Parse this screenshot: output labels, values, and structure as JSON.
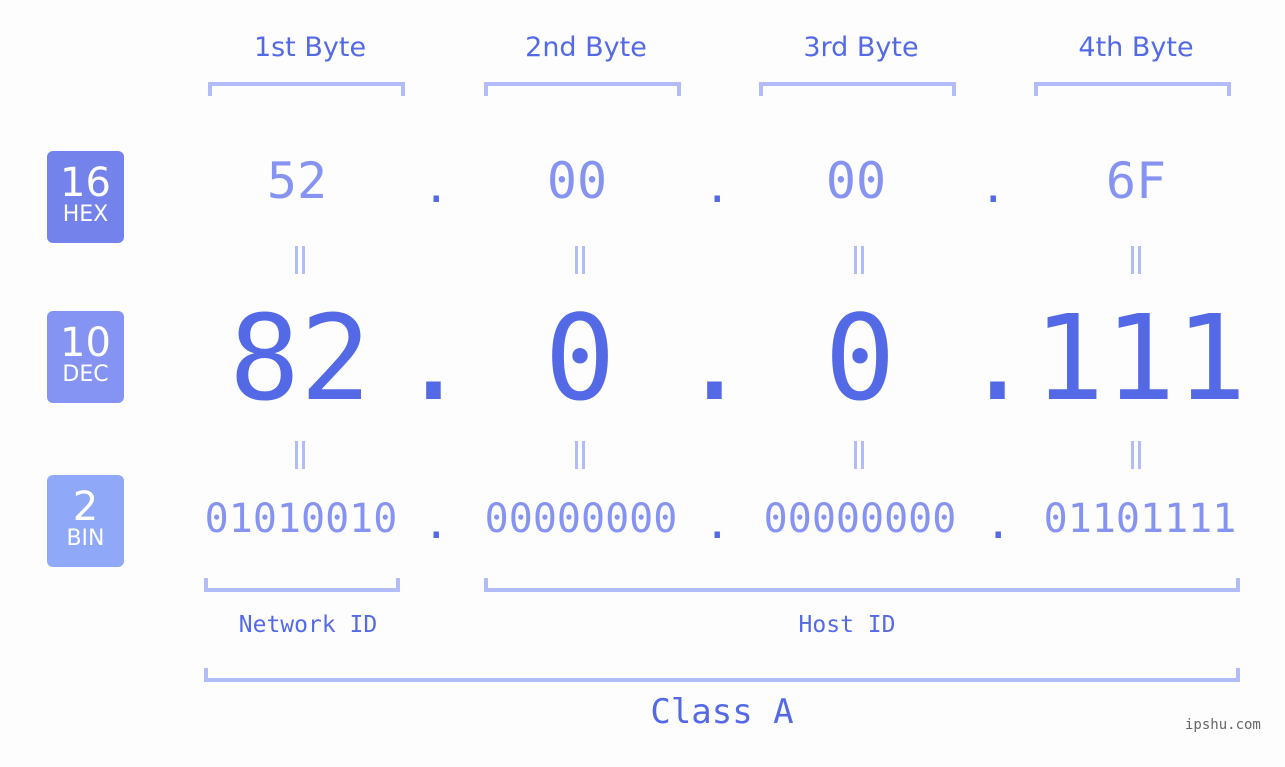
{
  "badges": [
    {
      "num": "16",
      "label": "HEX",
      "color": "#7482ec"
    },
    {
      "num": "10",
      "label": "DEC",
      "color": "#8593f2"
    },
    {
      "num": "2",
      "label": "BIN",
      "color": "#90a8f8"
    }
  ],
  "bytes": [
    {
      "header": "1st Byte",
      "hex": "52",
      "dec": "82",
      "bin": "01010010"
    },
    {
      "header": "2nd Byte",
      "hex": "00",
      "dec": "0",
      "bin": "00000000"
    },
    {
      "header": "3rd Byte",
      "hex": "00",
      "dec": "0",
      "bin": "00000000"
    },
    {
      "header": "4th Byte",
      "hex": "6F",
      "dec": "111",
      "bin": "01101111"
    }
  ],
  "separator": ".",
  "network_id_label": "Network ID",
  "host_id_label": "Host ID",
  "class_label": "Class A",
  "watermark": "ipshu.com",
  "colors": {
    "accent": "#5469e6",
    "light": "#8693f0",
    "bracket": "#b2bcf8"
  }
}
